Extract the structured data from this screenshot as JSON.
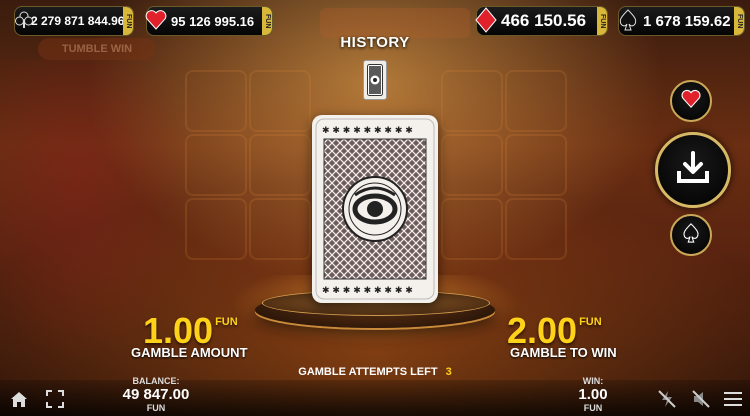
{
  "jackpots": [
    {
      "suit": "club",
      "amount": "2 279 871 844.96",
      "fun": "FUN"
    },
    {
      "suit": "heart",
      "amount": "95 126 995.16",
      "fun": "FUN"
    },
    {
      "suit": "diamond",
      "amount": "466 150.56",
      "fun": "FUN"
    },
    {
      "suit": "spade",
      "amount": "1 678 159.62",
      "fun": "FUN"
    }
  ],
  "background": {
    "tumble_label": "TUMBLE WIN"
  },
  "history": {
    "title": "HISTORY"
  },
  "gamble": {
    "amount_value": "1.00",
    "amount_currency": "FUN",
    "amount_label": "GAMBLE AMOUNT",
    "win_value": "2.00",
    "win_currency": "FUN",
    "win_label": "GAMBLE TO WIN",
    "attempts_label": "GAMBLE ATTEMPTS LEFT",
    "attempts_value": "3"
  },
  "side_buttons": {
    "top_icon": "heart-icon",
    "middle_icon": "download-icon",
    "bottom_icon": "spade-icon"
  },
  "balance": {
    "label": "BALANCE:",
    "value": "49 847.00",
    "currency": "FUN"
  },
  "win": {
    "label": "WIN:",
    "value": "1.00",
    "currency": "FUN"
  },
  "colors": {
    "accent_yellow": "#ffd21a",
    "gold_border": "#caa858",
    "red_suit": "#e0202a"
  }
}
